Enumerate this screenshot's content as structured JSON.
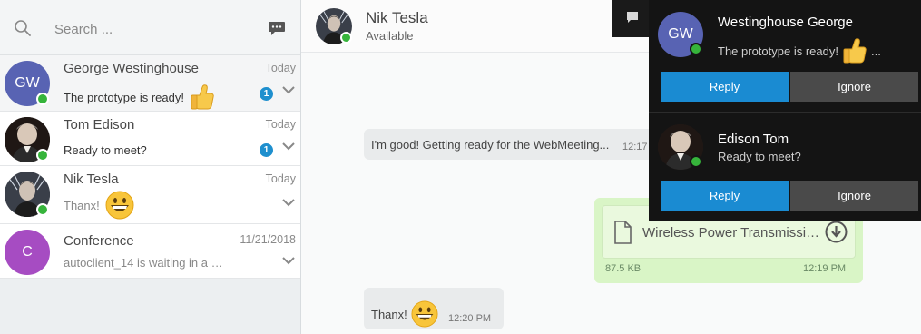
{
  "search": {
    "placeholder": "Search ..."
  },
  "conversations": [
    {
      "name": "George Westinghouse",
      "initials": "GW",
      "date": "Today",
      "preview": "The prototype is ready!",
      "unread": "1",
      "avatar_color": "#5863b3",
      "emoji": "thumbs-up"
    },
    {
      "name": "Tom Edison",
      "date": "Today",
      "preview": "Ready to meet?",
      "unread": "1",
      "emoji": ""
    },
    {
      "name": "Nik Tesla",
      "date": "Today",
      "preview": "Thanx!",
      "unread": "",
      "emoji": "grinning-face"
    },
    {
      "name": "Conference",
      "initials": "C",
      "date": "11/21/2018",
      "preview": "autoclient_14 is waiting in a …",
      "unread": "",
      "avatar_color": "#a64cc2",
      "emoji": ""
    }
  ],
  "chat": {
    "contact_name": "Nik Tesla",
    "contact_status": "Available",
    "messages": [
      {
        "direction": "incoming",
        "text": "I'm good! Getting ready for the WebMeeting...",
        "time": "12:17"
      },
      {
        "direction": "outgoing",
        "type": "file",
        "file_name": "Wireless Power Transmissi…",
        "file_size": "87.5 KB",
        "time": "12:19 PM"
      },
      {
        "direction": "incoming",
        "text": "Thanx!",
        "time": "12:20 PM",
        "emoji": "grinning-face"
      }
    ]
  },
  "notifications": [
    {
      "name": "Westinghouse George",
      "initials": "GW",
      "message": "The prototype is ready!",
      "emoji": "thumbs-up",
      "ellipsis": "...",
      "avatar_color": "#5863b3",
      "reply_label": "Reply",
      "ignore_label": "Ignore"
    },
    {
      "name": "Edison Tom",
      "message": "Ready to meet?",
      "reply_label": "Reply",
      "ignore_label": "Ignore"
    }
  ],
  "colors": {
    "accent_blue": "#1a8bd2",
    "online_green": "#36b43b",
    "outgoing_bubble": "#d9f5c6",
    "incoming_bubble": "#e9ebec",
    "notification_bg": "#141414",
    "ignore_button": "#4a4a4a"
  },
  "icons": {
    "search": "search-icon",
    "new_chat": "chat-bubble-icon",
    "expand": "chevron-down-icon",
    "file": "file-icon",
    "download": "download-circle-icon",
    "header_chat": "chat-bubble-icon"
  }
}
